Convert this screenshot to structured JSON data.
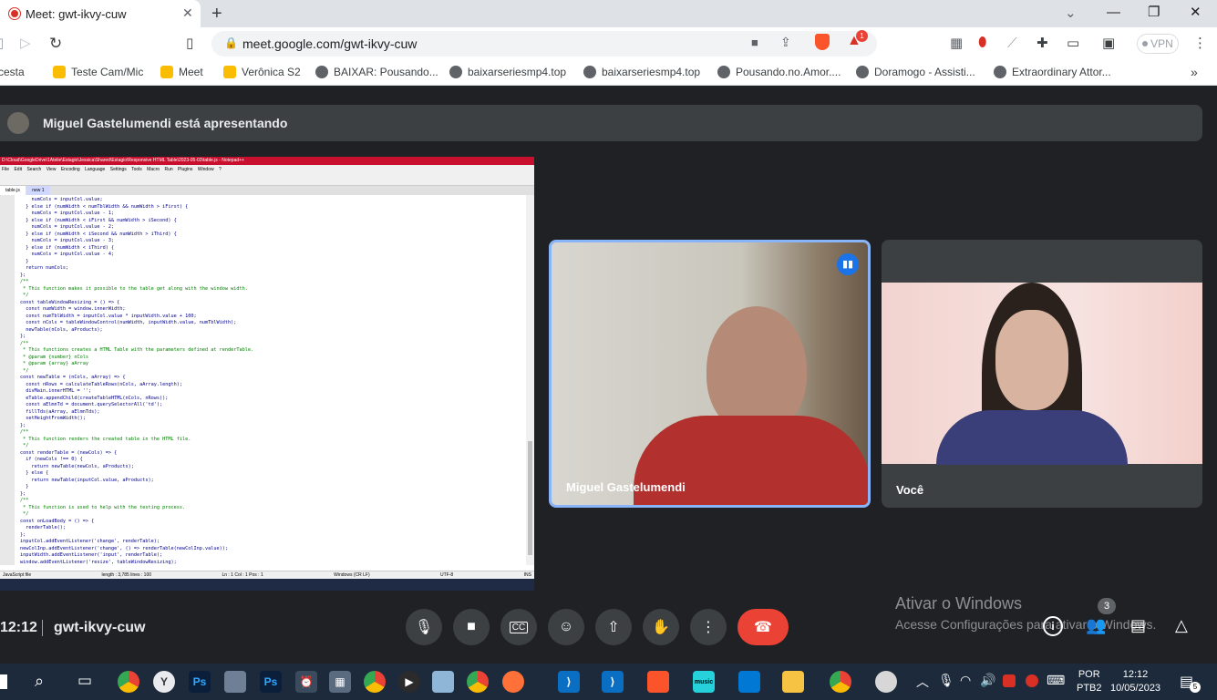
{
  "browser": {
    "tab_title": "Meet: gwt-ikvy-cuw",
    "url": "meet.google.com/gwt-ikvy-cuw",
    "vpn_label": "VPN",
    "brave_badge": "1"
  },
  "bookmarks": [
    {
      "label": "cesta",
      "icon": "folder-icon"
    },
    {
      "label": "Teste Cam/Mic",
      "icon": "meet-icon"
    },
    {
      "label": "Meet",
      "icon": "meet-icon"
    },
    {
      "label": "Verônica S2",
      "icon": "meet-icon"
    },
    {
      "label": "BAIXAR: Pousando...",
      "icon": "globe-icon"
    },
    {
      "label": "baixarseriesmp4.top",
      "icon": "globe-icon"
    },
    {
      "label": "baixarseriesmp4.top",
      "icon": "globe-icon"
    },
    {
      "label": "Pousando.no.Amor....",
      "icon": "globe-icon"
    },
    {
      "label": "Doramogo - Assisti...",
      "icon": "globe-icon"
    },
    {
      "label": "Extraordinary Attor...",
      "icon": "globe-icon"
    }
  ],
  "meet": {
    "presenter_text": "Miguel Gastelumendi está apresentando",
    "participants": [
      {
        "name": "Miguel Gastelumendi"
      },
      {
        "name": "Você"
      }
    ],
    "clock": "12:12",
    "meeting_code": "gwt-ikvy-cuw",
    "people_count": "3",
    "colors": {
      "end_call": "#ea4335",
      "active_border": "#8ab4f8",
      "background": "#202124"
    }
  },
  "shared_screen": {
    "title": "D:\\Cloud\\GoogleDrive\\1Atelie\\Estagio\\Jessica\\Shared\\Estagio\\Responsive HTML Table\\2023-05-03\\table.js - Notepad++",
    "menu": [
      "File",
      "Edit",
      "Search",
      "View",
      "Encoding",
      "Language",
      "Settings",
      "Tools",
      "Macro",
      "Run",
      "Plugins",
      "Window",
      "?"
    ],
    "tabs": [
      "table.js",
      "new 1"
    ],
    "status": [
      "JavaScript file",
      "length : 3,785   lines : 100",
      "Ln : 1   Col : 1   Pos : 1",
      "Windows (CR LF)",
      "UTF-8",
      "INS"
    ],
    "code_lines": [
      "    numCols = inputCol.value;",
      "  } else if (numWidth < numTblWidth && numWidth > iFirst) {",
      "    numCols = inputCol.value - 1;",
      "  } else if (numWidth < iFirst && numWidth > iSecond) {",
      "    numCols = inputCol.value - 2;",
      "  } else if (numWidth < iSecond && numWidth > iThird) {",
      "    numCols = inputCol.value - 3;",
      "  } else if (numWidth < iThird) {",
      "    numCols = inputCol.value - 4;",
      "  }",
      "  return numCols;",
      "};",
      "/**",
      " * This function makes it possible to the table get along with the window width.",
      " */",
      "const tableWindowResizing = () => {",
      "  const numWidth = window.innerWidth;",
      "  const numTblWidth = inputCol.value * inputWidth.value + 100;",
      "  const nCols = tableWindowControl(numWidth, inputWidth.value, numTblWidth);",
      "  newTable(nCols, aProducts);",
      "};",
      "/**",
      " * This functions creates a HTML Table with the parameters defined at renderTable.",
      " * @param {number} nCols",
      " * @param {array} aArray",
      " */",
      "const newTable = (nCols, aArray) => {",
      "  const nRows = calculateTableRows(nCols, aArray.length);",
      "  divMain.innerHTML = '';",
      "  eTable.appendChild(createTableHTML(nCols, nRows));",
      "  const aElmnTd = document.querySelectorAll('td');",
      "  fillTds(aArray, aElmnTds);",
      "  setHeightFromWidth();",
      "};",
      "/**",
      " * This function renders the created table in the HTML file.",
      " */",
      "const renderTable = (newCols) => {",
      "  if (newCols !== 0) {",
      "    return newTable(newCols, aProducts);",
      "  } else {",
      "    return newTable(inputCol.value, aProducts);",
      "  }",
      "};",
      "/**",
      " * This function is used to help with the testing process.",
      " */",
      "const onLoadBody = () => {",
      "  renderTable();",
      "};",
      "inputCol.addEventListener('change', renderTable);",
      "newColInp.addEventListener('change', () => renderTable(newColInp.value));",
      "inputWidth.addEventListener('input', renderTable);",
      "window.addEventListener('resize', tableWindowResizing);"
    ]
  },
  "watermark": {
    "title": "Ativar o Windows",
    "subtitle": "Acesse Configurações para ativar o Windows."
  },
  "taskbar": {
    "lang_top": "POR",
    "lang_bottom": "PTB2",
    "time": "12:12",
    "date": "10/05/2023",
    "notification_count": "5"
  }
}
